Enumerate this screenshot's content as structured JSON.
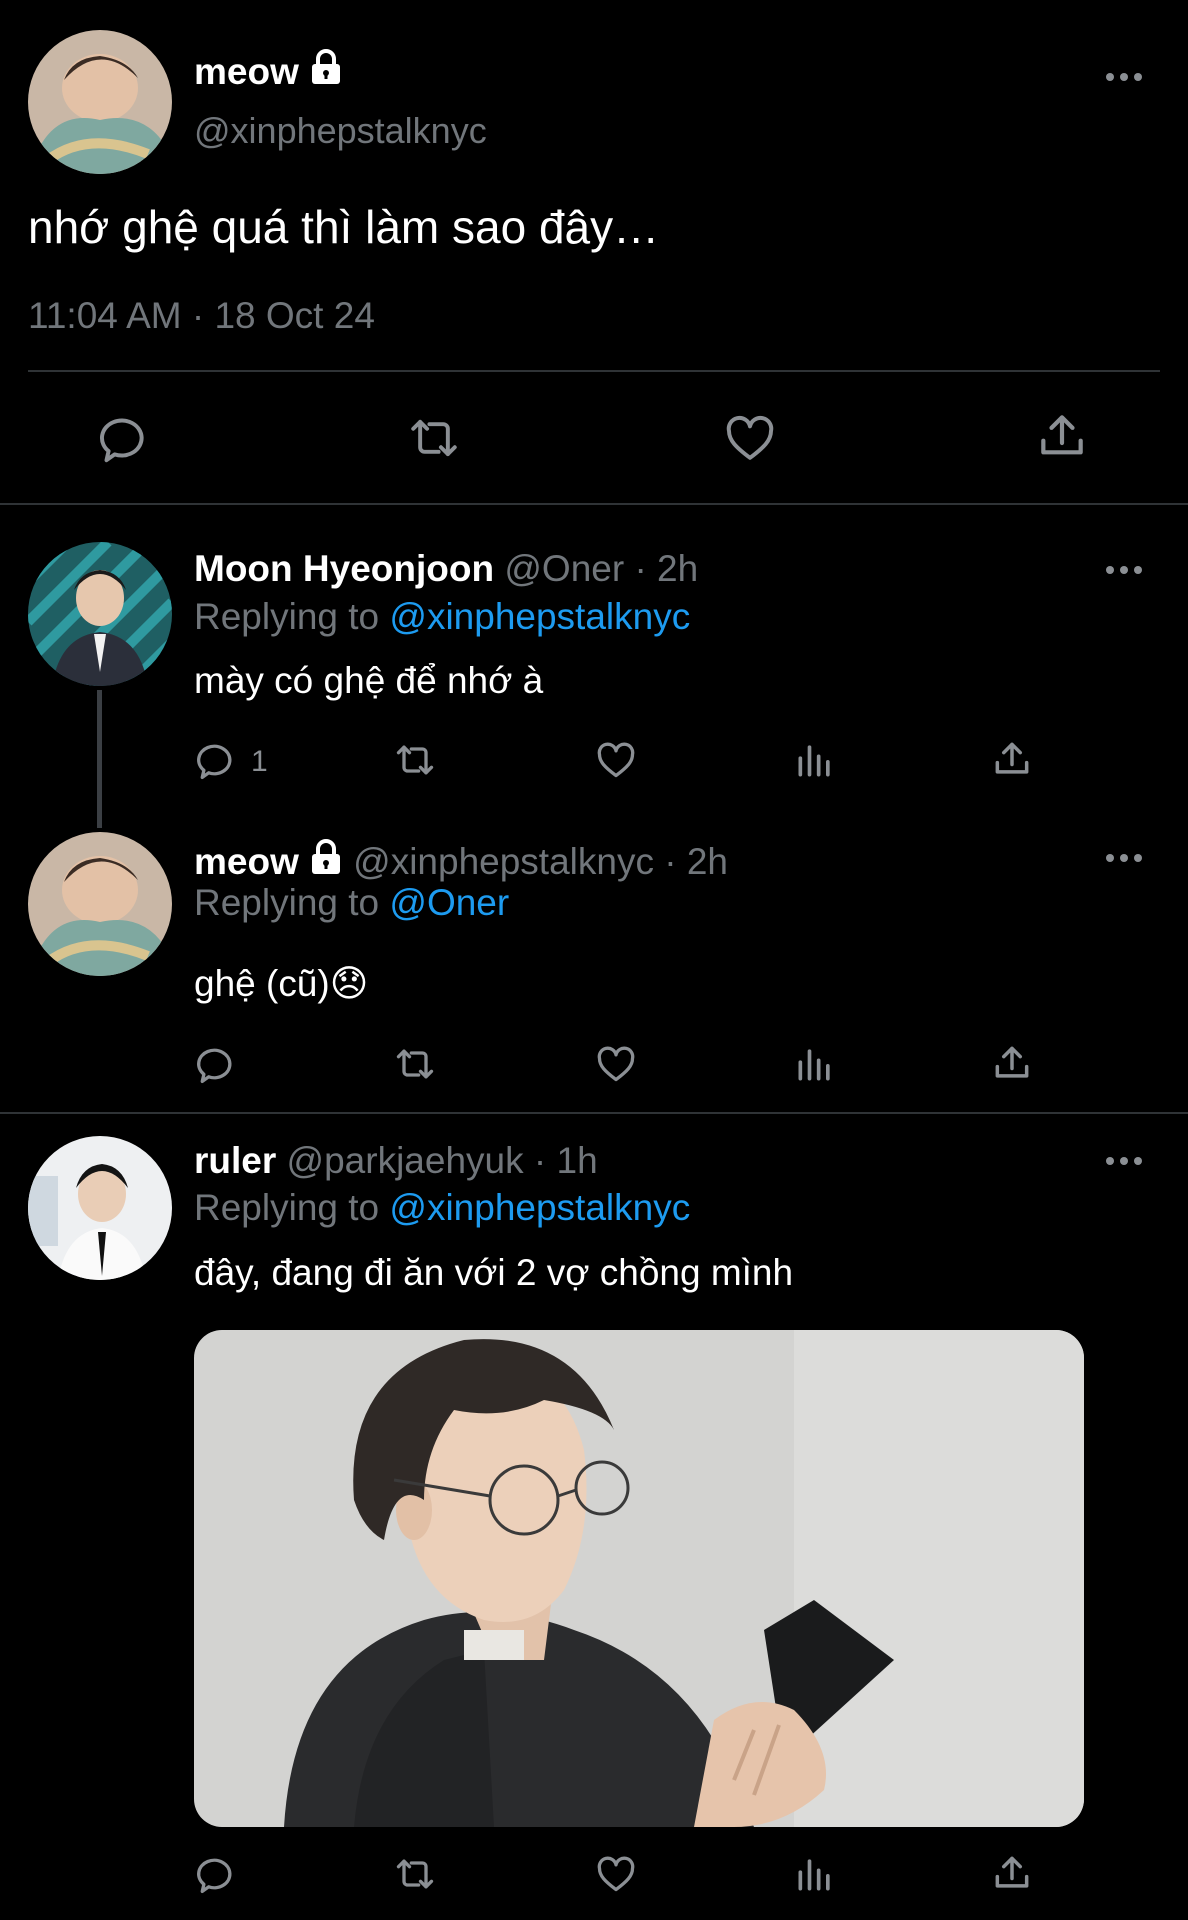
{
  "main_tweet": {
    "name": "meow",
    "handle": "@xinphepstalknyc",
    "text": "nhớ ghệ quá thì làm sao đây…",
    "timestamp": "11:04 AM · 18 Oct 24",
    "actions": [
      "reply-icon",
      "retweet-icon",
      "like-icon",
      "share-icon"
    ]
  },
  "replies": [
    {
      "name": "Moon Hyeonjoon",
      "meta": "@Oner · 2h",
      "replying_prefix": "Replying to ",
      "replying_to": "@xinphepstalknyc",
      "text": "mày có ghệ để nhớ à",
      "reply_count": "1"
    },
    {
      "name": "meow",
      "meta": "@xinphepstalknyc · 2h",
      "replying_prefix": "Replying to ",
      "replying_to": "@Oner",
      "text": "ghệ (cũ)😞",
      "reply_count": ""
    },
    {
      "name": "ruler",
      "meta": "@parkjaehyuk · 1h",
      "replying_prefix": "Replying to ",
      "replying_to": "@xinphepstalknyc",
      "text": "đây, đang đi ăn với 2 vợ chồng mình",
      "reply_count": ""
    }
  ],
  "colors": {
    "accent": "#1d9bf0",
    "background": "#000000",
    "muted": "#71767b"
  }
}
